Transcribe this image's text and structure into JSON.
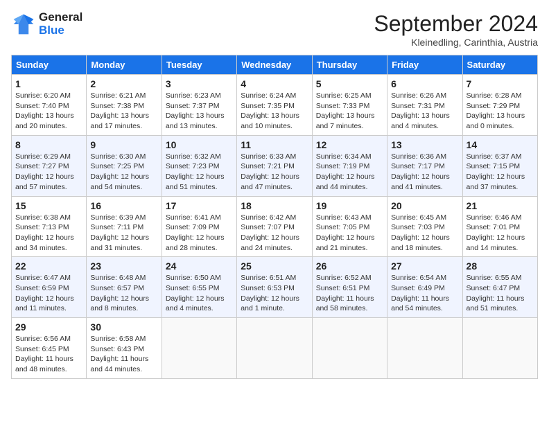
{
  "logo": {
    "line1": "General",
    "line2": "Blue"
  },
  "title": "September 2024",
  "subtitle": "Kleinedling, Carinthia, Austria",
  "headers": [
    "Sunday",
    "Monday",
    "Tuesday",
    "Wednesday",
    "Thursday",
    "Friday",
    "Saturday"
  ],
  "weeks": [
    [
      {
        "day": "1",
        "info": "Sunrise: 6:20 AM\nSunset: 7:40 PM\nDaylight: 13 hours and 20 minutes."
      },
      {
        "day": "2",
        "info": "Sunrise: 6:21 AM\nSunset: 7:38 PM\nDaylight: 13 hours and 17 minutes."
      },
      {
        "day": "3",
        "info": "Sunrise: 6:23 AM\nSunset: 7:37 PM\nDaylight: 13 hours and 13 minutes."
      },
      {
        "day": "4",
        "info": "Sunrise: 6:24 AM\nSunset: 7:35 PM\nDaylight: 13 hours and 10 minutes."
      },
      {
        "day": "5",
        "info": "Sunrise: 6:25 AM\nSunset: 7:33 PM\nDaylight: 13 hours and 7 minutes."
      },
      {
        "day": "6",
        "info": "Sunrise: 6:26 AM\nSunset: 7:31 PM\nDaylight: 13 hours and 4 minutes."
      },
      {
        "day": "7",
        "info": "Sunrise: 6:28 AM\nSunset: 7:29 PM\nDaylight: 13 hours and 0 minutes."
      }
    ],
    [
      {
        "day": "8",
        "info": "Sunrise: 6:29 AM\nSunset: 7:27 PM\nDaylight: 12 hours and 57 minutes."
      },
      {
        "day": "9",
        "info": "Sunrise: 6:30 AM\nSunset: 7:25 PM\nDaylight: 12 hours and 54 minutes."
      },
      {
        "day": "10",
        "info": "Sunrise: 6:32 AM\nSunset: 7:23 PM\nDaylight: 12 hours and 51 minutes."
      },
      {
        "day": "11",
        "info": "Sunrise: 6:33 AM\nSunset: 7:21 PM\nDaylight: 12 hours and 47 minutes."
      },
      {
        "day": "12",
        "info": "Sunrise: 6:34 AM\nSunset: 7:19 PM\nDaylight: 12 hours and 44 minutes."
      },
      {
        "day": "13",
        "info": "Sunrise: 6:36 AM\nSunset: 7:17 PM\nDaylight: 12 hours and 41 minutes."
      },
      {
        "day": "14",
        "info": "Sunrise: 6:37 AM\nSunset: 7:15 PM\nDaylight: 12 hours and 37 minutes."
      }
    ],
    [
      {
        "day": "15",
        "info": "Sunrise: 6:38 AM\nSunset: 7:13 PM\nDaylight: 12 hours and 34 minutes."
      },
      {
        "day": "16",
        "info": "Sunrise: 6:39 AM\nSunset: 7:11 PM\nDaylight: 12 hours and 31 minutes."
      },
      {
        "day": "17",
        "info": "Sunrise: 6:41 AM\nSunset: 7:09 PM\nDaylight: 12 hours and 28 minutes."
      },
      {
        "day": "18",
        "info": "Sunrise: 6:42 AM\nSunset: 7:07 PM\nDaylight: 12 hours and 24 minutes."
      },
      {
        "day": "19",
        "info": "Sunrise: 6:43 AM\nSunset: 7:05 PM\nDaylight: 12 hours and 21 minutes."
      },
      {
        "day": "20",
        "info": "Sunrise: 6:45 AM\nSunset: 7:03 PM\nDaylight: 12 hours and 18 minutes."
      },
      {
        "day": "21",
        "info": "Sunrise: 6:46 AM\nSunset: 7:01 PM\nDaylight: 12 hours and 14 minutes."
      }
    ],
    [
      {
        "day": "22",
        "info": "Sunrise: 6:47 AM\nSunset: 6:59 PM\nDaylight: 12 hours and 11 minutes."
      },
      {
        "day": "23",
        "info": "Sunrise: 6:48 AM\nSunset: 6:57 PM\nDaylight: 12 hours and 8 minutes."
      },
      {
        "day": "24",
        "info": "Sunrise: 6:50 AM\nSunset: 6:55 PM\nDaylight: 12 hours and 4 minutes."
      },
      {
        "day": "25",
        "info": "Sunrise: 6:51 AM\nSunset: 6:53 PM\nDaylight: 12 hours and 1 minute."
      },
      {
        "day": "26",
        "info": "Sunrise: 6:52 AM\nSunset: 6:51 PM\nDaylight: 11 hours and 58 minutes."
      },
      {
        "day": "27",
        "info": "Sunrise: 6:54 AM\nSunset: 6:49 PM\nDaylight: 11 hours and 54 minutes."
      },
      {
        "day": "28",
        "info": "Sunrise: 6:55 AM\nSunset: 6:47 PM\nDaylight: 11 hours and 51 minutes."
      }
    ],
    [
      {
        "day": "29",
        "info": "Sunrise: 6:56 AM\nSunset: 6:45 PM\nDaylight: 11 hours and 48 minutes."
      },
      {
        "day": "30",
        "info": "Sunrise: 6:58 AM\nSunset: 6:43 PM\nDaylight: 11 hours and 44 minutes."
      },
      {
        "day": "",
        "info": ""
      },
      {
        "day": "",
        "info": ""
      },
      {
        "day": "",
        "info": ""
      },
      {
        "day": "",
        "info": ""
      },
      {
        "day": "",
        "info": ""
      }
    ]
  ]
}
